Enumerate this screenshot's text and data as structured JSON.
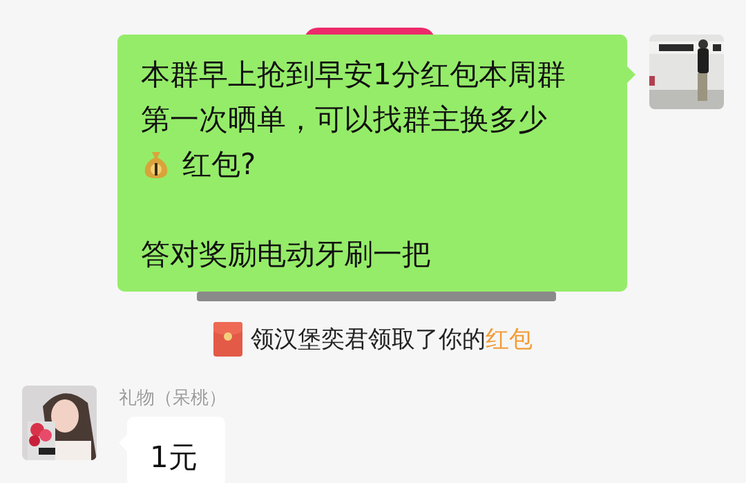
{
  "messages": [
    {
      "kind": "outgoing",
      "avatar": {
        "kind": "picture"
      },
      "image_behind": {
        "kind": "picture"
      },
      "paragraphs": [
        {
          "lines": [
            {
              "text": "本群早上抢到早安1分红包本周群"
            },
            {
              "text": "第一次晒单，可以找群主换多少"
            },
            {
              "kind": "emoji",
              "text": "红包?"
            }
          ]
        },
        {
          "lines": [
            {
              "text": "答对奖励电动牙刷一把"
            }
          ]
        }
      ]
    },
    {
      "kind": "notice",
      "text": "领汉堡奕君领取了你的",
      "link": "红包"
    },
    {
      "kind": "incoming",
      "avatar": {
        "kind": "picture"
      },
      "sender": "礼物（呆桃）",
      "paragraphs": [
        {
          "lines": [
            {
              "text": "1元"
            }
          ]
        }
      ]
    }
  ]
}
